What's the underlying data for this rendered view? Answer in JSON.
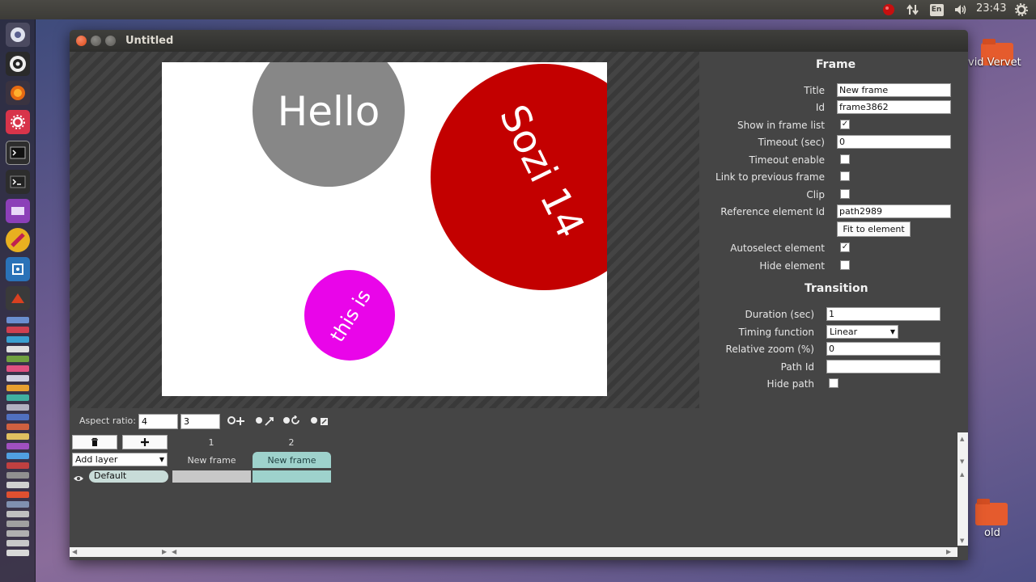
{
  "panel": {
    "clock": "23:43",
    "keyboard_layout": "En",
    "icons": [
      "ubuntu-one-icon",
      "network-icon",
      "keyboard-layout-icon",
      "volume-icon",
      "settings-icon"
    ]
  },
  "launcher": {
    "icons": [
      "dash-icon",
      "obs-icon",
      "firefox-icon",
      "settings-icon",
      "terminal-icon",
      "terminal-2-icon",
      "app-icon",
      "app-icon",
      "app-icon",
      "app-icon"
    ]
  },
  "desktop": {
    "icons": [
      {
        "label": "vid Vervet"
      },
      {
        "label": "old"
      }
    ]
  },
  "window": {
    "title": "Untitled"
  },
  "slide": {
    "texts": {
      "hello": "Hello",
      "sozi": "Sozi 14",
      "this_is": "this is"
    },
    "colors": {
      "gray_circle": "#878787",
      "red_circle": "#c30000",
      "magenta_circle": "#e905e9"
    }
  },
  "frame": {
    "section_title": "Frame",
    "title_label": "Title",
    "title_value": "New frame",
    "id_label": "Id",
    "id_value": "frame3862",
    "show_in_list_label": "Show in frame list",
    "show_in_list_checked": true,
    "timeout_label": "Timeout (sec)",
    "timeout_value": "0",
    "timeout_enable_label": "Timeout enable",
    "timeout_enable_checked": false,
    "link_prev_label": "Link to previous frame",
    "link_prev_checked": false,
    "clip_label": "Clip",
    "clip_checked": false,
    "ref_label": "Reference element Id",
    "ref_value": "path2989",
    "fit_button": "Fit to element",
    "autoselect_label": "Autoselect element",
    "autoselect_checked": true,
    "hide_element_label": "Hide element",
    "hide_element_checked": false
  },
  "transition": {
    "section_title": "Transition",
    "duration_label": "Duration (sec)",
    "duration_value": "1",
    "timing_label": "Timing function",
    "timing_value": "Linear",
    "zoom_label": "Relative zoom (%)",
    "zoom_value": "0",
    "path_label": "Path Id",
    "path_value": "",
    "hide_path_label": "Hide path",
    "hide_path_checked": false
  },
  "toolbar": {
    "aspect_label": "Aspect ratio:",
    "aspect_w": "4",
    "aspect_h": "3"
  },
  "timeline": {
    "add_layer": "Add layer",
    "frames": [
      {
        "number": "1",
        "title": "New frame",
        "selected": false
      },
      {
        "number": "2",
        "title": "New frame",
        "selected": true
      }
    ],
    "layers": [
      {
        "name": "Default"
      }
    ],
    "colors": {
      "selected": "#9ed2cc",
      "cell_default": "#c8c8c8"
    }
  }
}
